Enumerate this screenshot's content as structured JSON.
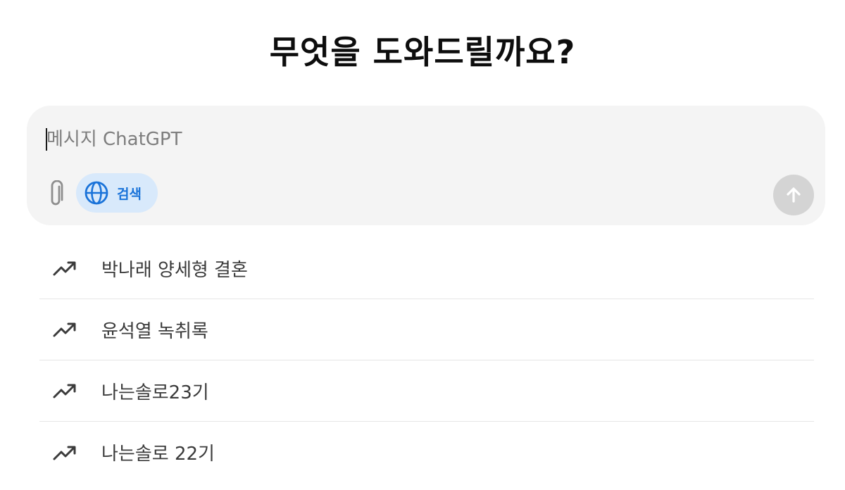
{
  "header": {
    "title": "무엇을 도와드릴까요?"
  },
  "composer": {
    "placeholder": "메시지 ChatGPT",
    "value": "",
    "attach_icon": "paperclip-icon",
    "search": {
      "icon": "globe-icon",
      "label": "검색",
      "color": "#1a73d9",
      "background": "#d8e9fb"
    },
    "send_icon": "arrow-up-icon"
  },
  "suggestions": {
    "icon": "trending-up-icon",
    "items": [
      {
        "label": "박나래 양세형 결혼"
      },
      {
        "label": "윤석열 녹취록"
      },
      {
        "label": "나는솔로23기"
      },
      {
        "label": "나는솔로 22기"
      }
    ]
  }
}
